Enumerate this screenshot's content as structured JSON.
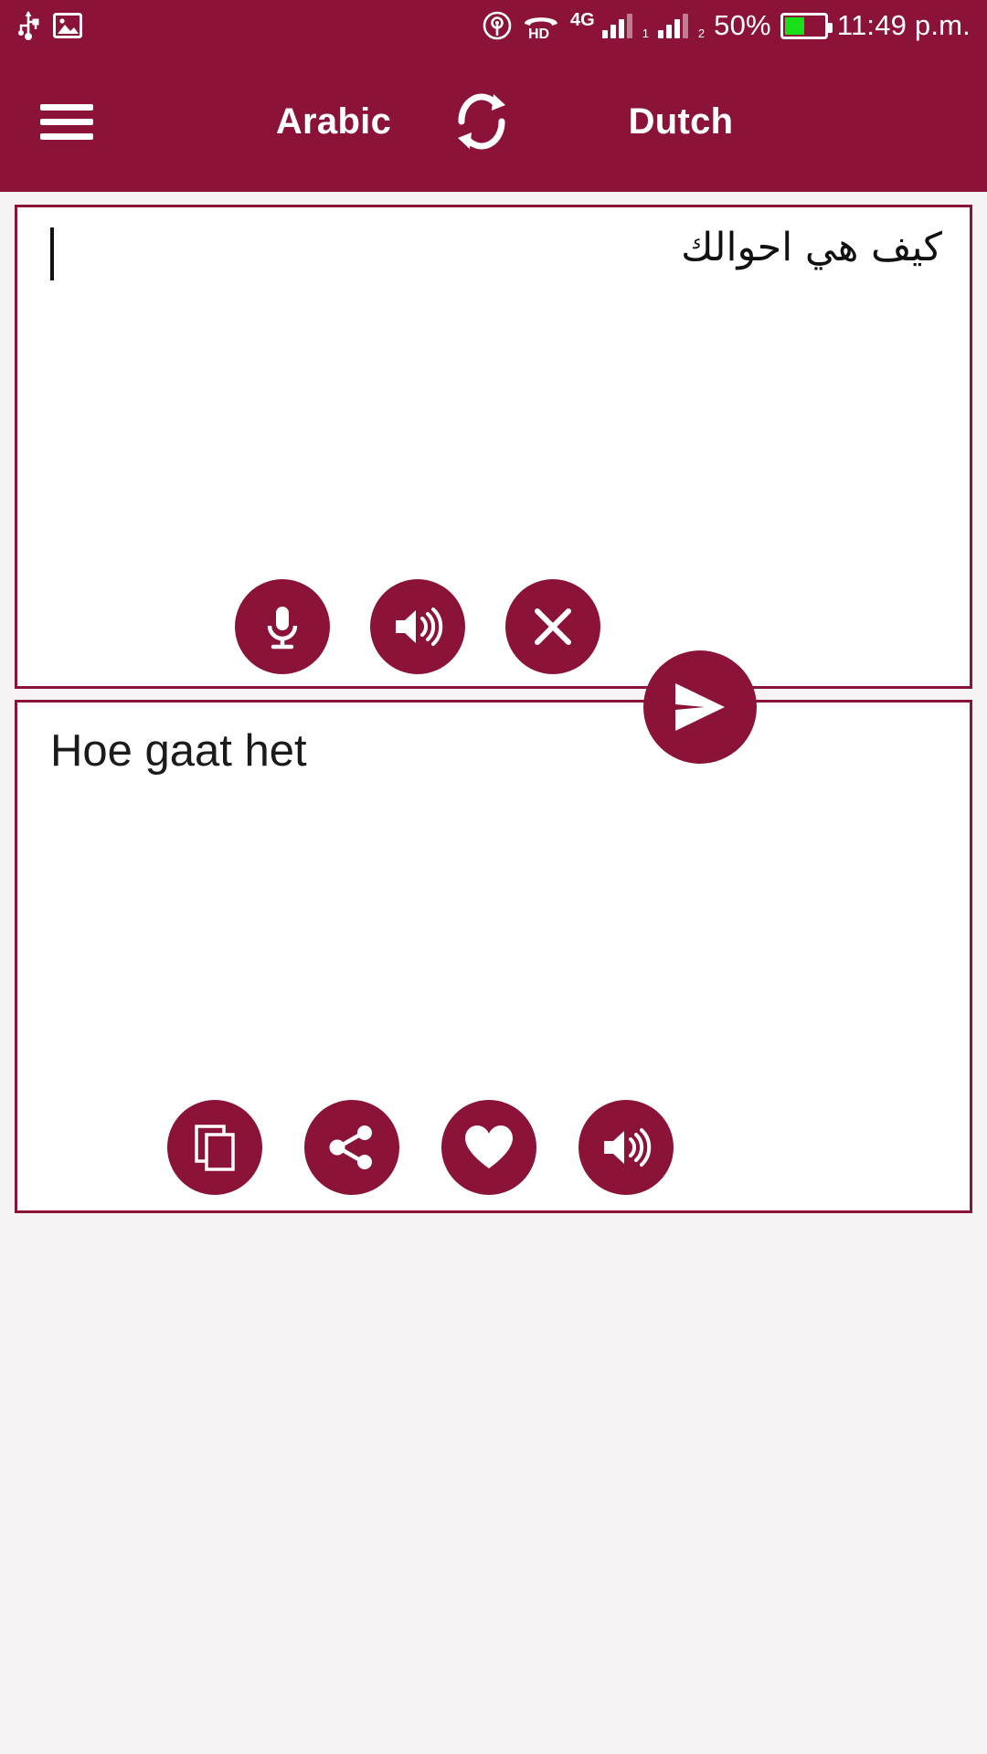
{
  "status_bar": {
    "left_icons": [
      "usb-icon",
      "screenshot-image-icon"
    ],
    "hotspot_icon": "hotspot-icon",
    "hd_label": "HD",
    "network_label": "4G",
    "sim1_label": "1",
    "sim2_label": "2",
    "battery_percent": "50%",
    "battery_level": 50,
    "battery_color": "#18E018",
    "time": "11:49 p.m."
  },
  "app_bar": {
    "menu_icon": "hamburger-menu-icon",
    "source_language": "Arabic",
    "swap_icon": "swap-languages-icon",
    "target_language": "Dutch",
    "background_color": "#8C1338"
  },
  "input_card": {
    "text": "كيف هي احوالك",
    "buttons": [
      {
        "name": "microphone-button",
        "icon": "microphone-icon"
      },
      {
        "name": "speak-input-button",
        "icon": "speaker-icon"
      },
      {
        "name": "clear-input-button",
        "icon": "close-x-icon"
      }
    ]
  },
  "send_button": {
    "name": "translate-send-button",
    "icon": "send-paper-plane-icon"
  },
  "output_card": {
    "text": "Hoe gaat het",
    "buttons": [
      {
        "name": "copy-button",
        "icon": "copy-icon"
      },
      {
        "name": "share-button",
        "icon": "share-icon"
      },
      {
        "name": "favorite-button",
        "icon": "heart-icon"
      },
      {
        "name": "speak-output-button",
        "icon": "speaker-icon"
      }
    ]
  },
  "theme": {
    "primary": "#8C1338",
    "card_bg": "#FFFFFF",
    "page_bg": "#F5F3F4"
  }
}
